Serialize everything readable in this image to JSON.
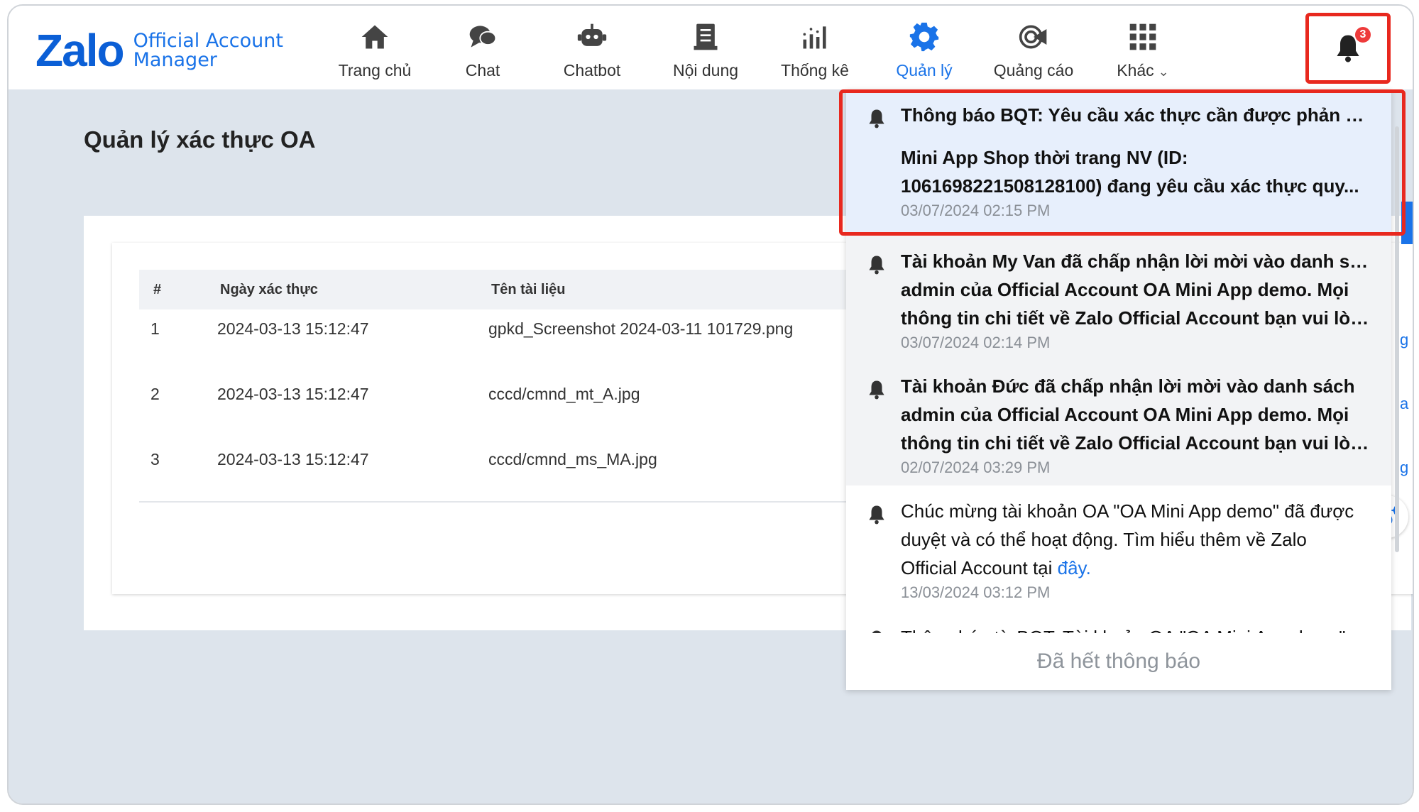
{
  "brand": {
    "logo_word": "Zalo",
    "sub_line1": "Official Account",
    "sub_line2": "Manager"
  },
  "nav": [
    {
      "label": "Trang chủ",
      "icon": "home-icon"
    },
    {
      "label": "Chat",
      "icon": "chat-icon"
    },
    {
      "label": "Chatbot",
      "icon": "robot-icon"
    },
    {
      "label": "Nội dung",
      "icon": "document-icon"
    },
    {
      "label": "Thống kê",
      "icon": "bar-chart-icon"
    },
    {
      "label": "Quản lý",
      "icon": "gear-icon",
      "active": true
    },
    {
      "label": "Quảng cáo",
      "icon": "megaphone-icon"
    },
    {
      "label": "Khác",
      "icon": "grid-icon"
    }
  ],
  "notifications_badge": "3",
  "page": {
    "title": "Quản lý xác thực OA",
    "table": {
      "columns": [
        "#",
        "Ngày xác thực",
        "Tên tài liệu"
      ],
      "rows": [
        [
          "1",
          "2024-03-13 15:12:47",
          "gpkd_Screenshot 2024-03-11 101729.png"
        ],
        [
          "2",
          "2024-03-13 15:12:47",
          "cccd/cmnd_mt_A.jpg"
        ],
        [
          "3",
          "2024-03-13 15:12:47",
          "cccd/cmnd_ms_MA.jpg"
        ]
      ]
    }
  },
  "notification_panel": {
    "items": [
      {
        "title": "Thông báo BQT: Yêu cầu xác thực cần được phản hồi.",
        "line1": "Mini App Shop thời trang NV (ID:",
        "line2": "1061698221508128100) đang yêu cầu xác thực quy...",
        "time": "03/07/2024 02:15 PM"
      },
      {
        "line1": "Tài khoản My Van đã chấp nhận lời mời vào danh sách",
        "line2": "admin của Official Account OA Mini App demo. Mọi",
        "line3": "thông tin chi tiết về Zalo Official Account bạn vui lòn...",
        "time": "03/07/2024 02:14 PM"
      },
      {
        "line1": "Tài khoản Đức đã chấp nhận lời mời vào danh sách",
        "line2": "admin của Official Account OA Mini App demo. Mọi",
        "line3": "thông tin chi tiết về Zalo Official Account bạn vui lòn...",
        "time": "02/07/2024 03:29 PM"
      },
      {
        "line1": "Chúc mừng tài khoản OA \"OA Mini App demo\" đã được",
        "line2": "duyệt và có thể hoạt động. Tìm hiểu thêm về Zalo",
        "line3_prefix": "Official Account tại ",
        "link": "đây",
        "line3_suffix": ".",
        "time": "13/03/2024 03:12 PM"
      },
      {
        "line1": "Thông báo từ BQT: Tài khoản OA \"OA Mini App demo\""
      }
    ],
    "end_text": "Đã hết thông báo"
  },
  "colors": {
    "accent": "#1a73e8",
    "highlight_border": "#e8281e",
    "badge": "#ee3b3b",
    "page_bg": "#dde4ec"
  }
}
